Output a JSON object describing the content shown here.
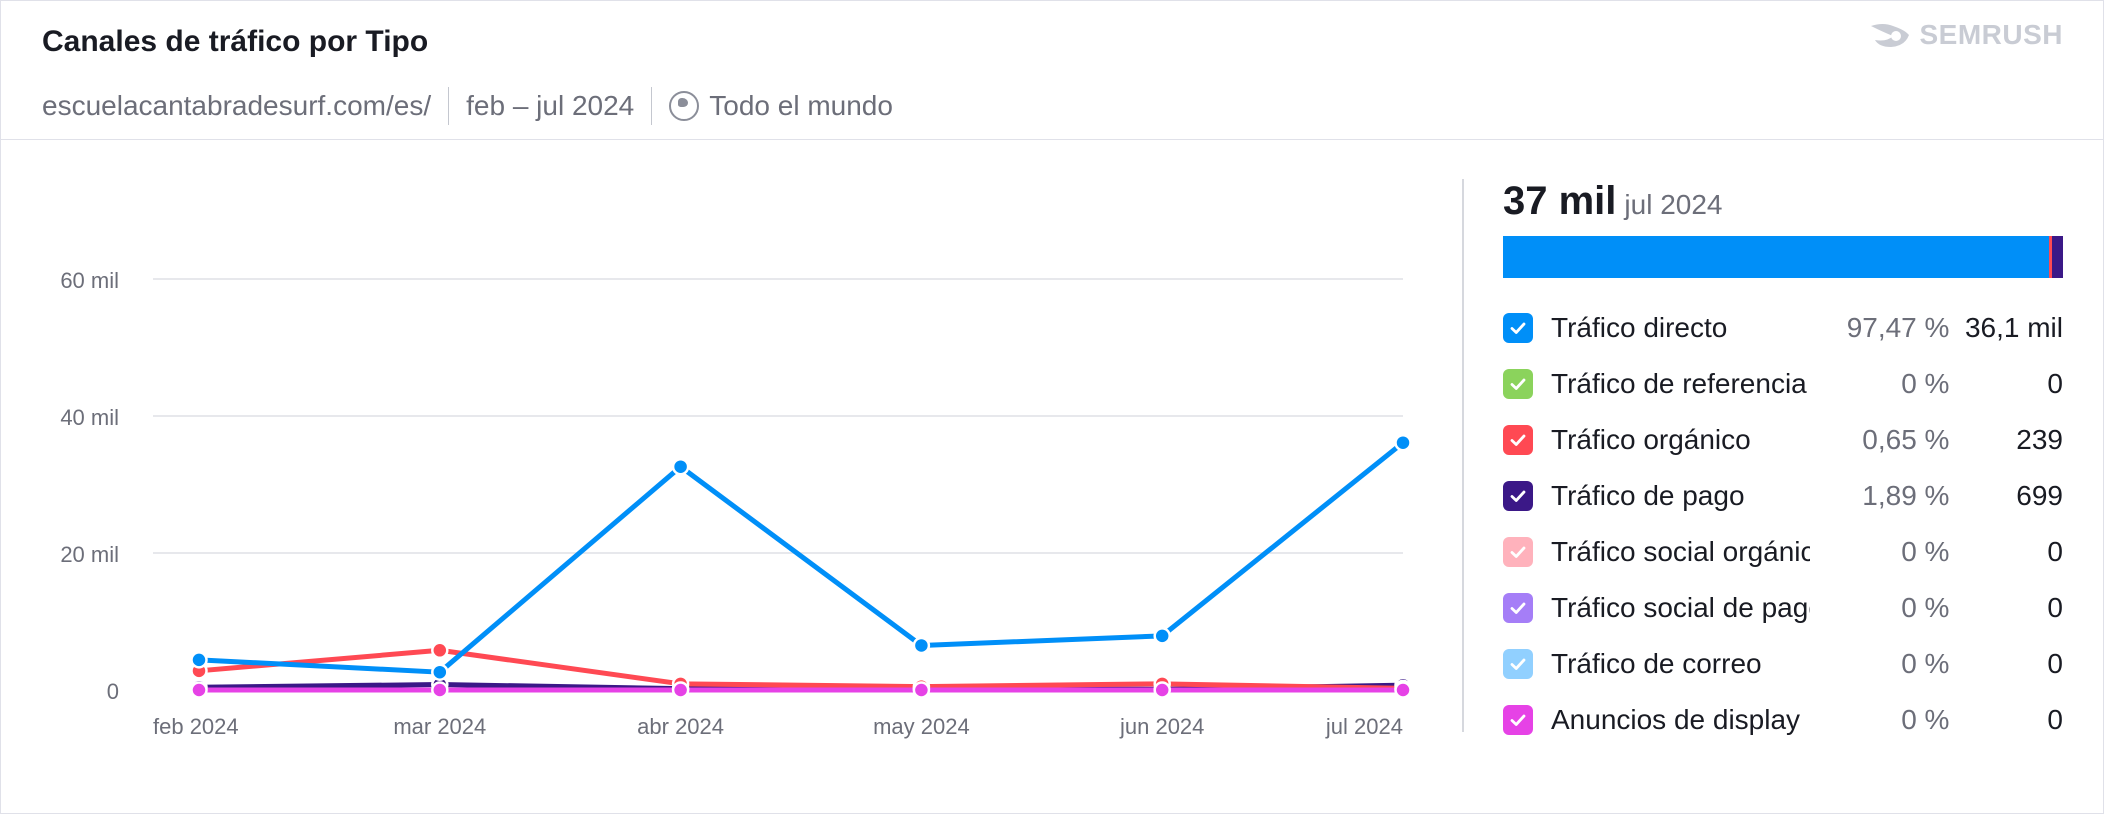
{
  "header": {
    "title": "Canales de tráfico por Tipo",
    "domain": "escuelacantabradesurf.com/es/",
    "period": "feb – jul 2024",
    "region": "Todo el mundo",
    "brand": "SEMRUSH",
    "brand_icon": "semrush-fire-icon"
  },
  "summary": {
    "total": "37 mil",
    "period": "jul 2024"
  },
  "legend": [
    {
      "label": "Tráfico directo",
      "pct": "97,47 %",
      "value": "36,1 mil",
      "color": "#008ff8",
      "share": 97.47
    },
    {
      "label": "Tráfico de referencia",
      "pct": "0 %",
      "value": "0",
      "color": "#8bd35c",
      "share": 0
    },
    {
      "label": "Tráfico orgánico",
      "pct": "0,65 %",
      "value": "239",
      "color": "#ff4953",
      "share": 0.65
    },
    {
      "label": "Tráfico de pago",
      "pct": "1,89 %",
      "value": "699",
      "color": "#3b1887",
      "share": 1.89
    },
    {
      "label": "Tráfico social orgánico",
      "pct": "0 %",
      "value": "0",
      "color": "#ffb2bc",
      "share": 0
    },
    {
      "label": "Tráfico social de pago",
      "pct": "0 %",
      "value": "0",
      "color": "#a57ef7",
      "share": 0
    },
    {
      "label": "Tráfico de correo",
      "pct": "0 %",
      "value": "0",
      "color": "#91d0ff",
      "share": 0
    },
    {
      "label": "Anuncios de display",
      "pct": "0 %",
      "value": "0",
      "color": "#e642e6",
      "share": 0
    }
  ],
  "chart_data": {
    "type": "line",
    "categories": [
      "feb 2024",
      "mar 2024",
      "abr 2024",
      "may 2024",
      "jun 2024",
      "jul 2024"
    ],
    "ylim": [
      0,
      70000
    ],
    "yticks": [
      0,
      20000,
      40000,
      60000
    ],
    "ytick_labels": [
      "0",
      "20 mil",
      "40 mil",
      "60 mil"
    ],
    "grid": true,
    "series": [
      {
        "name": "Tráfico de pago",
        "color": "#3b1887",
        "values": [
          400,
          800,
          200,
          200,
          100,
          699
        ]
      },
      {
        "name": "Tráfico orgánico",
        "color": "#ff4953",
        "values": [
          2800,
          5800,
          900,
          500,
          900,
          239
        ]
      },
      {
        "name": "Tráfico directo",
        "color": "#008ff8",
        "values": [
          4400,
          2600,
          32600,
          6500,
          7900,
          36100
        ]
      },
      {
        "name": "Anuncios de display",
        "color": "#e642e6",
        "values": [
          0,
          0,
          0,
          0,
          0,
          0
        ]
      }
    ]
  }
}
